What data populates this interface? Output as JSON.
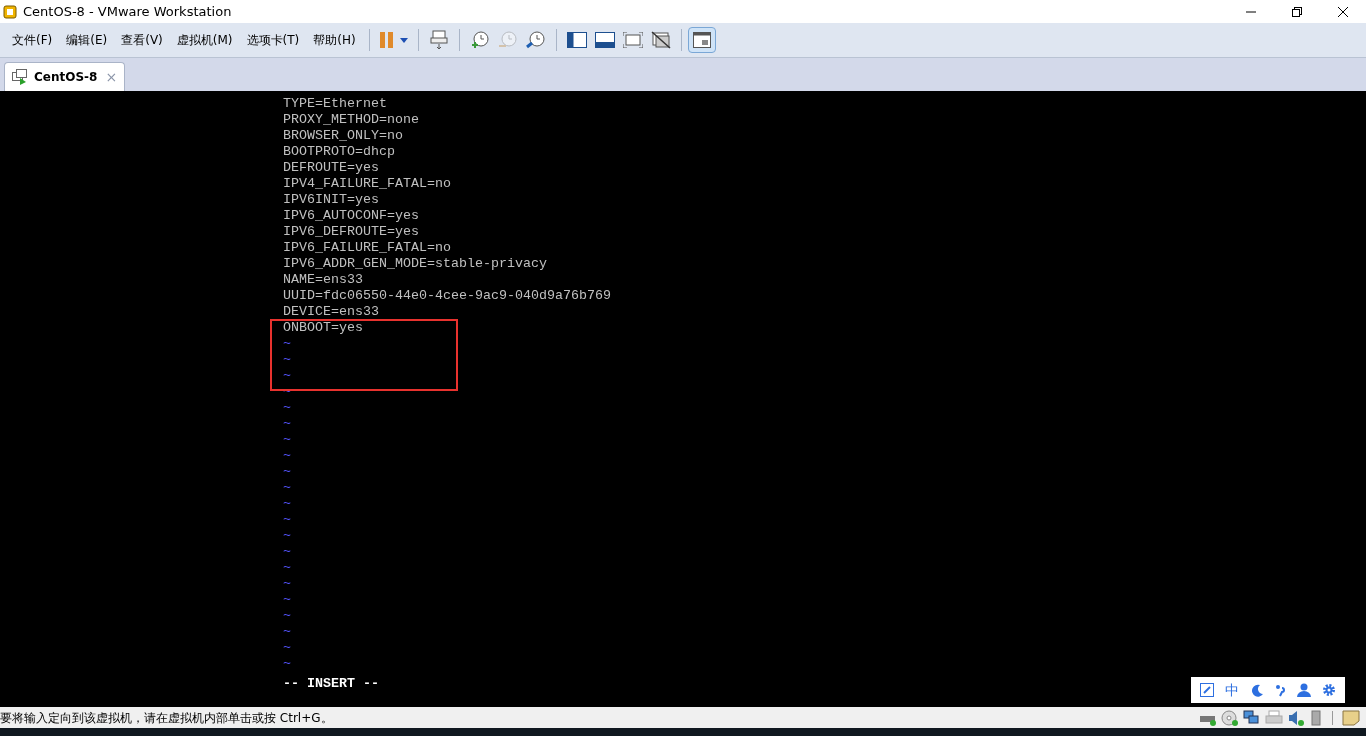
{
  "window": {
    "title": "CentOS-8 - VMware Workstation"
  },
  "menu": [
    "文件(F)",
    "编辑(E)",
    "查看(V)",
    "虚拟机(M)",
    "选项卡(T)",
    "帮助(H)"
  ],
  "toolbar": {
    "view_toggle_selected": true
  },
  "tabs": [
    {
      "label": "CentOS-8",
      "close": "×",
      "selected": true
    }
  ],
  "terminal": {
    "lines": [
      "TYPE=Ethernet",
      "PROXY_METHOD=none",
      "BROWSER_ONLY=no",
      "BOOTPROTO=dhcp",
      "DEFROUTE=yes",
      "IPV4_FAILURE_FATAL=no",
      "IPV6INIT=yes",
      "IPV6_AUTOCONF=yes",
      "IPV6_DEFROUTE=yes",
      "IPV6_FAILURE_FATAL=no",
      "IPV6_ADDR_GEN_MODE=stable-privacy",
      "NAME=ens33",
      "UUID=fdc06550-44e0-4cee-9ac9-040d9a76b769",
      "DEVICE=ens33",
      "ONBOOT=yes"
    ],
    "empty_markers": [
      "~",
      "~",
      "~",
      "~",
      "~",
      "~",
      "~",
      "~",
      "~",
      "~",
      "~",
      "~",
      "~",
      "~",
      "~",
      "~",
      "~",
      "~",
      "~",
      "~",
      "~"
    ],
    "mode": "-- INSERT --"
  },
  "ime_bar": {
    "language": "中"
  },
  "status_bar": {
    "message": "要将输入定向到该虚拟机，请在虚拟机内部单击或按 Ctrl+G。"
  }
}
